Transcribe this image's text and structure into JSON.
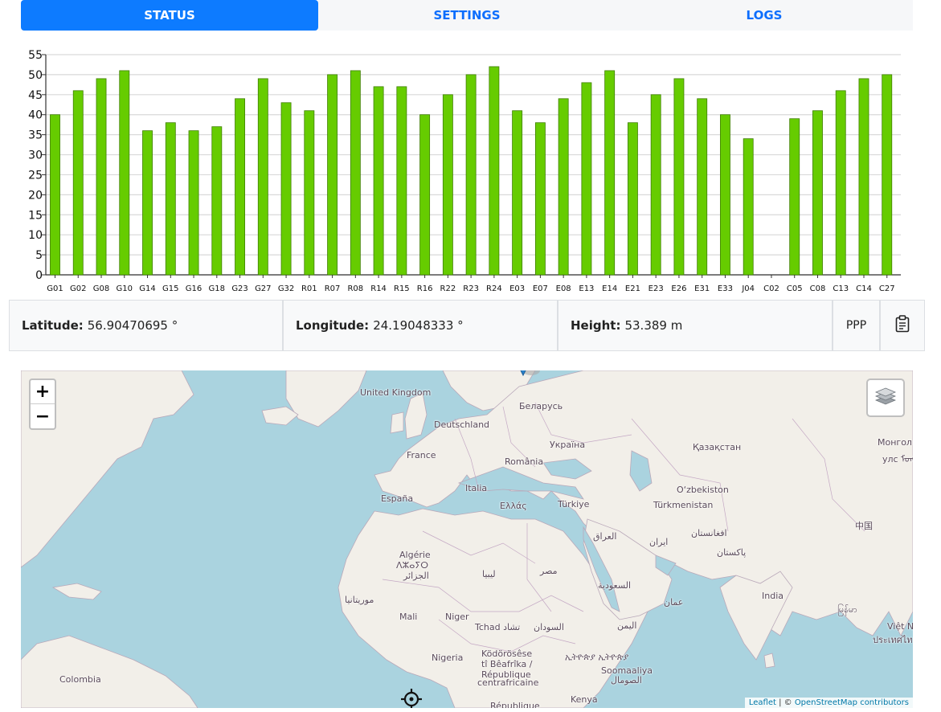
{
  "tabs": [
    {
      "label": "STATUS",
      "active": true
    },
    {
      "label": "SETTINGS",
      "active": false
    },
    {
      "label": "LOGS",
      "active": false
    }
  ],
  "chart_data": {
    "type": "bar",
    "categories": [
      "G01",
      "G02",
      "G08",
      "G10",
      "G14",
      "G15",
      "G16",
      "G18",
      "G23",
      "G27",
      "G32",
      "R01",
      "R07",
      "R08",
      "R14",
      "R15",
      "R16",
      "R22",
      "R23",
      "R24",
      "E03",
      "E07",
      "E08",
      "E13",
      "E14",
      "E21",
      "E23",
      "E26",
      "E31",
      "E33",
      "J04",
      "C02",
      "C05",
      "C08",
      "C13",
      "C14",
      "C27"
    ],
    "values": [
      40,
      46,
      49,
      51,
      36,
      38,
      36,
      37,
      44,
      49,
      43,
      41,
      50,
      51,
      47,
      47,
      40,
      45,
      50,
      52,
      41,
      38,
      44,
      48,
      51,
      38,
      45,
      49,
      44,
      40,
      34,
      0,
      39,
      41,
      46,
      49,
      50
    ],
    "ylim": [
      0,
      55
    ],
    "yticks": [
      0,
      5,
      10,
      15,
      20,
      25,
      30,
      35,
      40,
      45,
      50,
      55
    ],
    "grid": true,
    "bar_color": "#66cc00"
  },
  "position": {
    "latitude_label": "Latitude:",
    "latitude_value": "56.90470695 °",
    "longitude_label": "Longitude:",
    "longitude_value": "24.19048333 °",
    "height_label": "Height:",
    "height_value": "53.389 m",
    "mode": "PPP",
    "copy_icon": "clipboard-icon"
  },
  "map": {
    "zoom_in": "+",
    "zoom_out": "−",
    "layers_icon": "layers-icon",
    "locate_icon": "crosshair-icon",
    "marker_icon": "map-marker-icon",
    "attribution_leaflet": "Leaflet",
    "attribution_sep": " | © ",
    "attribution_osm": "OpenStreetMap contributors",
    "labels": [
      {
        "name": "uk",
        "text": "United Kingdom"
      },
      {
        "name": "de",
        "text": "Deutschland"
      },
      {
        "name": "by",
        "text": "Беларусь"
      },
      {
        "name": "ua",
        "text": "Україна"
      },
      {
        "name": "fr",
        "text": "France"
      },
      {
        "name": "ro",
        "text": "România"
      },
      {
        "name": "kz",
        "text": "Қазақстан"
      },
      {
        "name": "mn",
        "text": "Монгол"
      },
      {
        "name": "mn2",
        "text": "улс ᠮᠣᠩᠭᠣᠯ"
      },
      {
        "name": "es",
        "text": "España"
      },
      {
        "name": "it",
        "text": "Italia"
      },
      {
        "name": "uz",
        "text": "O‘zbekiston"
      },
      {
        "name": "gr",
        "text": "Ελλάς"
      },
      {
        "name": "tr",
        "text": "Türkiye"
      },
      {
        "name": "tm",
        "text": "Türkmenistan"
      },
      {
        "name": "cn",
        "text": "中国"
      },
      {
        "name": "iq",
        "text": "العراق"
      },
      {
        "name": "af",
        "text": "افغانستان"
      },
      {
        "name": "ir",
        "text": "ایران"
      },
      {
        "name": "pk",
        "text": "پاکستان"
      },
      {
        "name": "dz1",
        "text": "Algérie"
      },
      {
        "name": "dz2",
        "text": "ⴷⵣⴰⵢⵔ"
      },
      {
        "name": "dz3",
        "text": "الجزائر"
      },
      {
        "name": "ly",
        "text": "ليبيا"
      },
      {
        "name": "eg",
        "text": "مصر"
      },
      {
        "name": "sa",
        "text": "السعودية"
      },
      {
        "name": "om",
        "text": "عمان"
      },
      {
        "name": "in",
        "text": "India"
      },
      {
        "name": "mr",
        "text": "موريتانيا"
      },
      {
        "name": "ml",
        "text": "Mali"
      },
      {
        "name": "ne",
        "text": "Niger"
      },
      {
        "name": "td",
        "text": "Tchad تشاد"
      },
      {
        "name": "sd",
        "text": "السودان"
      },
      {
        "name": "ye",
        "text": "اليمن"
      },
      {
        "name": "mm",
        "text": "မြန်မာ"
      },
      {
        "name": "vn",
        "text": "Việt N"
      },
      {
        "name": "th",
        "text": "ประเทศไท"
      },
      {
        "name": "cf1",
        "text": "Ködörösêse"
      },
      {
        "name": "cf2",
        "text": "tî Bêafrîka /"
      },
      {
        "name": "cf3",
        "text": "République"
      },
      {
        "name": "cf4",
        "text": "centrafricaine"
      },
      {
        "name": "ng",
        "text": "Nigeria"
      },
      {
        "name": "et",
        "text": "ኢትዮጵያ ኢትዮጵያ"
      },
      {
        "name": "so1",
        "text": "Soomaaliya"
      },
      {
        "name": "so2",
        "text": "الصومال"
      },
      {
        "name": "co",
        "text": "Colombia"
      },
      {
        "name": "ke",
        "text": "Kenya"
      },
      {
        "name": "cg",
        "text": "République"
      }
    ]
  }
}
